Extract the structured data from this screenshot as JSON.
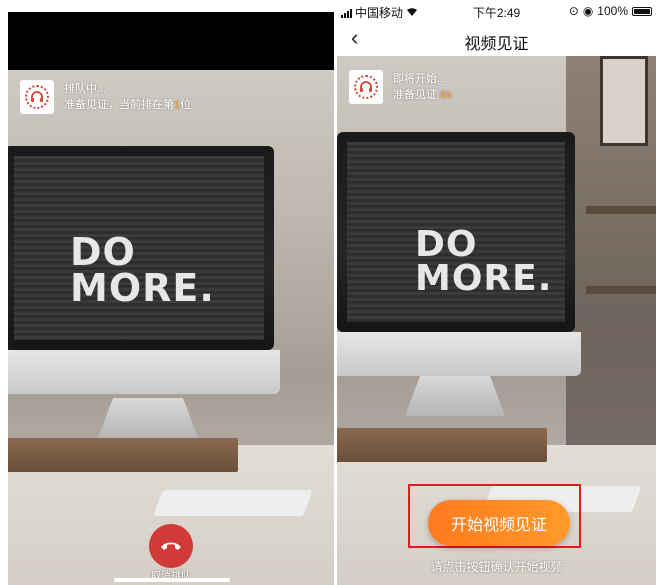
{
  "left_screen": {
    "status": {
      "title": "排队中...",
      "line_prefix": "准备见证，当前排在第",
      "position": "1",
      "line_suffix": "位"
    },
    "background_text": {
      "line1": "DO",
      "line2": "MORE."
    },
    "cancel_button_label": "取消排队"
  },
  "right_screen": {
    "status_bar": {
      "carrier": "中国移动",
      "time": "下午2:49",
      "battery": "100%"
    },
    "nav": {
      "back_icon": "‹",
      "title": "视频见证"
    },
    "status": {
      "title": "即将开始...",
      "line_prefix": "准备见证",
      "countdown": "6s"
    },
    "background_text": {
      "line1": "DO",
      "line2": "MORE."
    },
    "start_button_label": "开始视频见证",
    "hint": "请点击按钮确认开始视频"
  },
  "colors": {
    "accent_orange": "#ff8a22",
    "hangup_red": "#d23a3a",
    "highlight_red": "#e21b1b"
  }
}
